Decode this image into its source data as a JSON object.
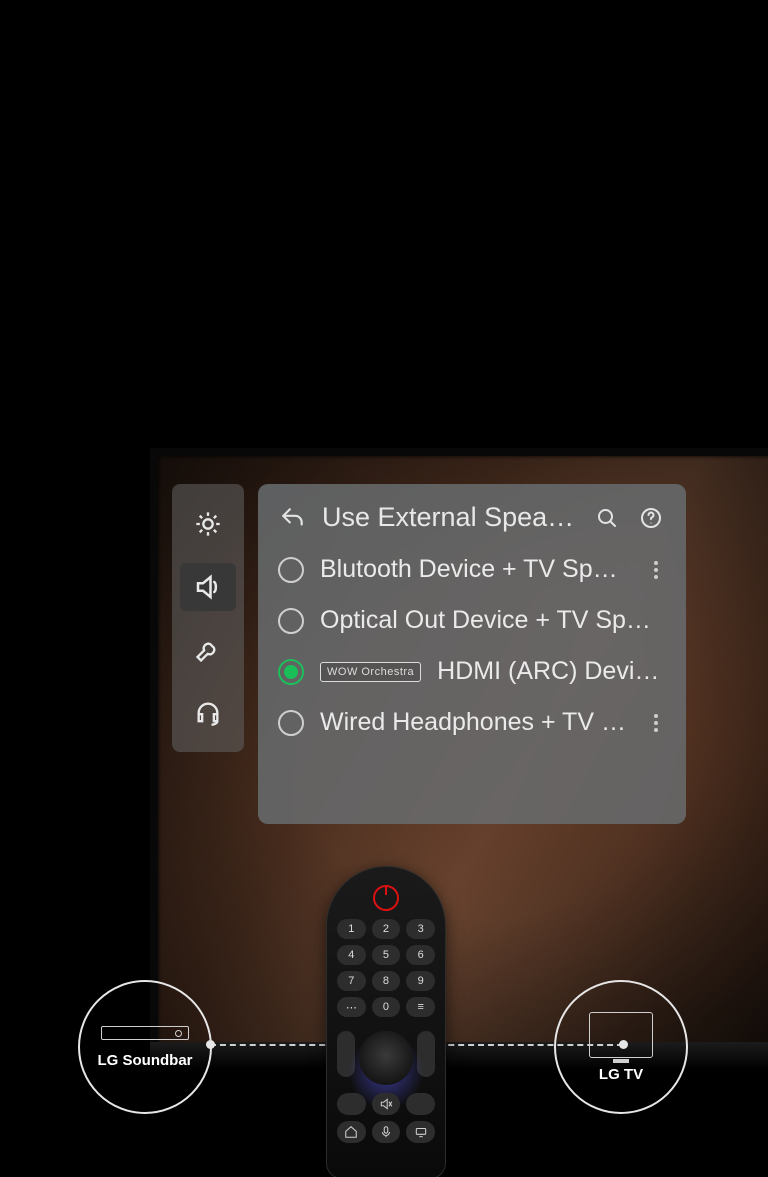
{
  "panel_title": "Use External Speak…",
  "side_tabs": [
    "brightness-icon",
    "sound-icon",
    "tools-icon",
    "headset-icon"
  ],
  "active_tab_index": 1,
  "options": [
    {
      "label": "Blutooth Device + TV Spea…",
      "selected": false,
      "more": true,
      "badge": null
    },
    {
      "label": "Optical Out Device + TV Sp…",
      "selected": false,
      "more": false,
      "badge": null
    },
    {
      "label": "HDMI (ARC) Devi…",
      "selected": true,
      "more": false,
      "badge": "WOW Orchestra"
    },
    {
      "label": "Wired Headphones + TV Sp…",
      "selected": false,
      "more": true,
      "badge": null
    }
  ],
  "devices": {
    "left": "LG Soundbar",
    "right": "LG TV"
  },
  "remote_numbers": [
    "1",
    "2",
    "3",
    "4",
    "5",
    "6",
    "7",
    "8",
    "9",
    "⋯",
    "0",
    "≡"
  ]
}
